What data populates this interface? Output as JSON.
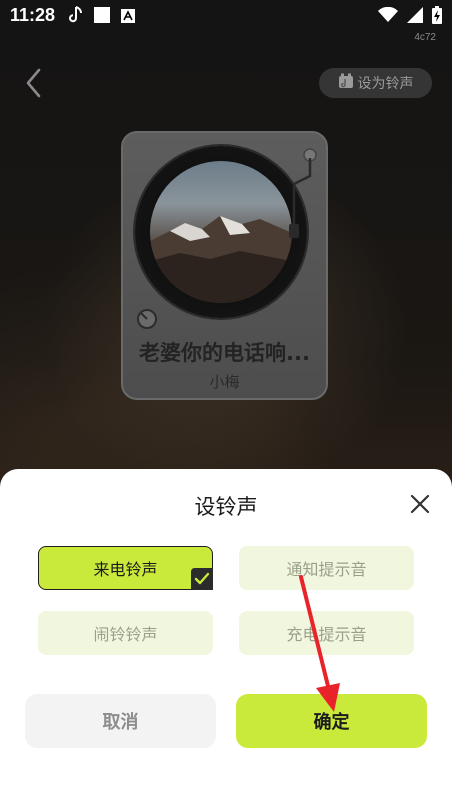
{
  "status_bar": {
    "time": "11:28",
    "build_tag": "4c72"
  },
  "top_bar": {
    "set_ringtone_label": "设为铃声"
  },
  "player": {
    "song_title": "老婆你的电话响...",
    "artist": "小梅"
  },
  "sheet": {
    "title": "设铃声",
    "options": [
      {
        "label": "来电铃声",
        "selected": true
      },
      {
        "label": "通知提示音",
        "selected": false
      },
      {
        "label": "闹铃铃声",
        "selected": false
      },
      {
        "label": "充电提示音",
        "selected": false
      }
    ],
    "cancel_label": "取消",
    "confirm_label": "确定"
  },
  "colors": {
    "accent": "#c9ea3a",
    "option_unselected_bg": "#f1f7df",
    "annotation_red": "#e8232a"
  }
}
